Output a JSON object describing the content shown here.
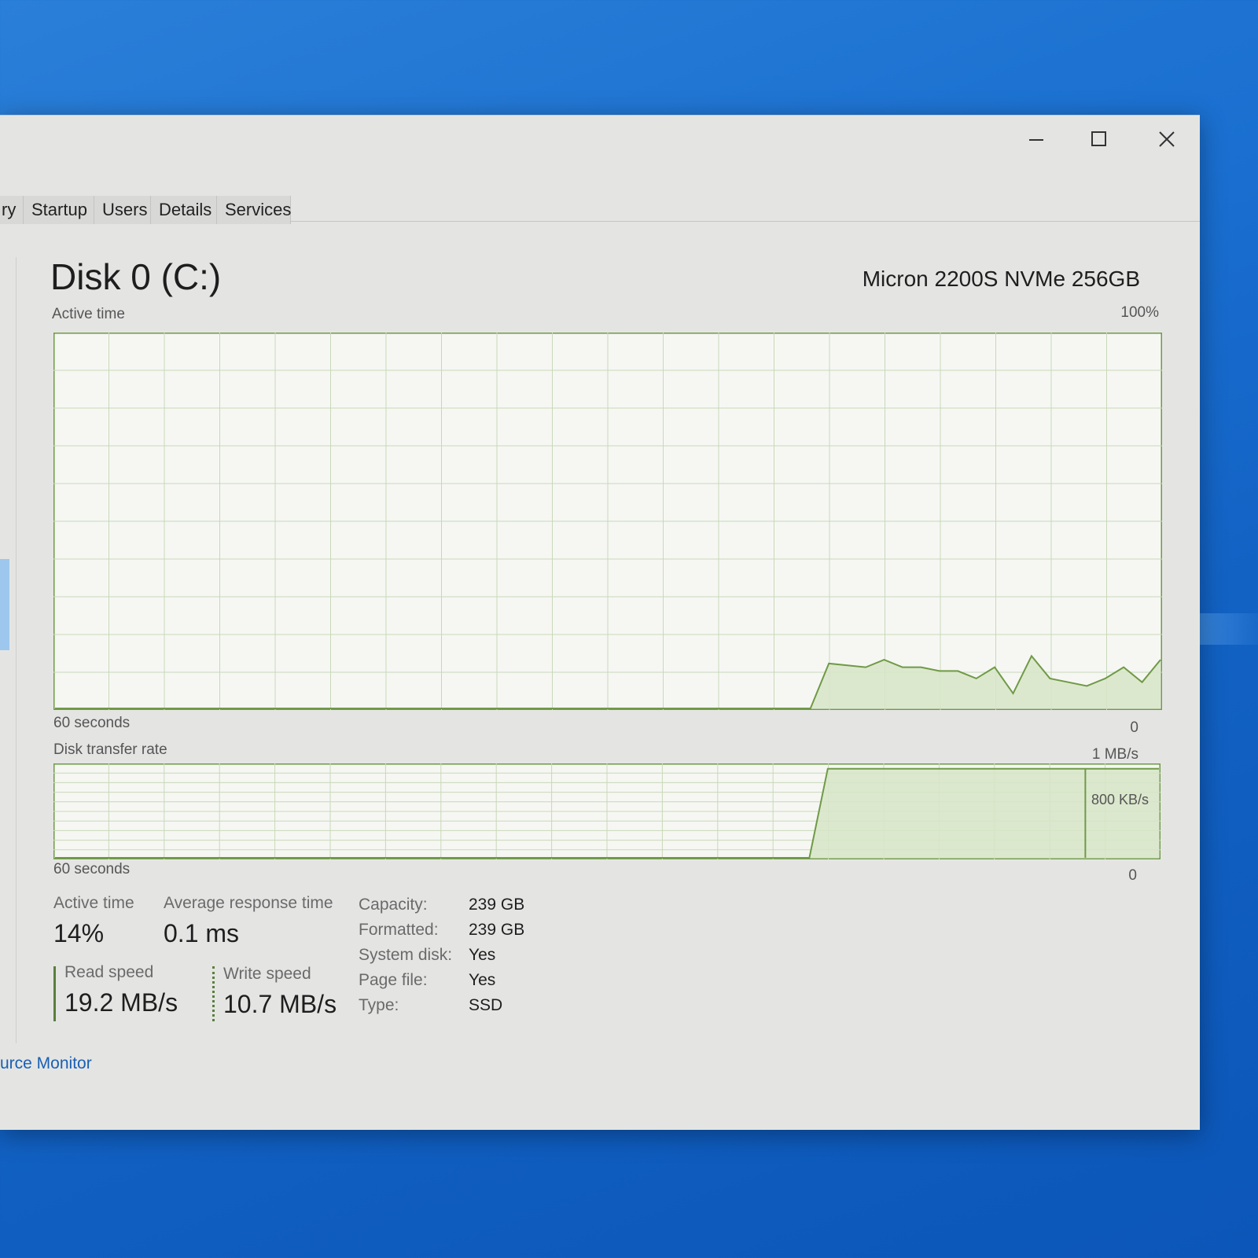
{
  "window": {
    "tabs": [
      {
        "label": "ry"
      },
      {
        "label": "Startup"
      },
      {
        "label": "Users"
      },
      {
        "label": "Details"
      },
      {
        "label": "Services"
      }
    ]
  },
  "disk": {
    "title": "Disk 0 (C:)",
    "model": "Micron 2200S NVMe 256GB"
  },
  "active_graph": {
    "label": "Active time",
    "max_label": "100%",
    "time_label": "60 seconds",
    "min_label": "0"
  },
  "transfer_graph": {
    "label": "Disk transfer rate",
    "max_label": "1 MB/s",
    "mid_label": "800 KB/s",
    "time_label": "60 seconds",
    "min_label": "0"
  },
  "stats": {
    "active_time_label": "Active time",
    "active_time_value": "14%",
    "avg_response_label": "Average response time",
    "avg_response_value": "0.1 ms",
    "read_speed_label": "Read speed",
    "read_speed_value": "19.2 MB/s",
    "write_speed_label": "Write speed",
    "write_speed_value": "10.7 MB/s"
  },
  "properties": [
    {
      "key": "Capacity:",
      "value": "239 GB"
    },
    {
      "key": "Formatted:",
      "value": "239 GB"
    },
    {
      "key": "System disk:",
      "value": "Yes"
    },
    {
      "key": "Page file:",
      "value": "Yes"
    },
    {
      "key": "Type:",
      "value": "SSD"
    }
  ],
  "footer": {
    "resource_monitor_link": "urce Monitor"
  },
  "colors": {
    "graph_line": "#6f9a47",
    "graph_fill": "#d7e5c7",
    "grid": "#c8d8b8"
  },
  "chart_data": [
    {
      "type": "area",
      "title": "Active time",
      "xlabel": "60 seconds",
      "ylim": [
        0,
        100
      ],
      "x": [
        0,
        41,
        42,
        44,
        45,
        46,
        47,
        48,
        49,
        50,
        51,
        52,
        53,
        54,
        55,
        56,
        57,
        58,
        59,
        60
      ],
      "values": [
        0,
        0,
        12,
        11,
        13,
        11,
        11,
        10,
        10,
        8,
        11,
        4,
        14,
        8,
        7,
        6,
        8,
        11,
        7,
        13
      ]
    },
    {
      "type": "area",
      "title": "Disk transfer rate",
      "xlabel": "60 seconds",
      "ylim": [
        0,
        1
      ],
      "x": [
        0,
        41,
        42,
        55,
        56,
        60
      ],
      "values": [
        0,
        0,
        0.96,
        0.96,
        0.96,
        0.96
      ]
    }
  ]
}
